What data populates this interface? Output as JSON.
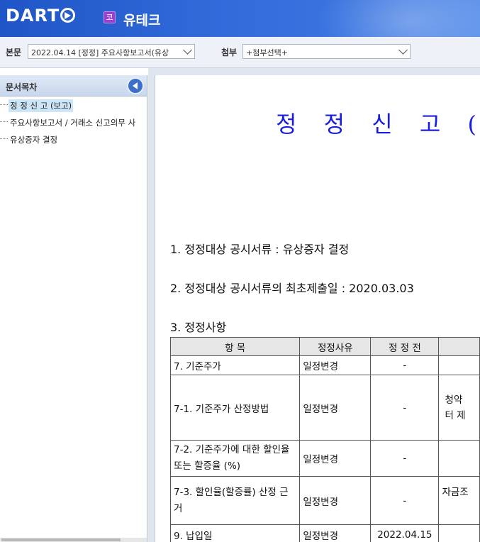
{
  "header": {
    "logo": "DART",
    "corp_badge": "코",
    "corp_name": "유테크"
  },
  "toolbar": {
    "body_label": "본문",
    "body_select": "2022.04.14 [정정] 주요사항보고서(유상",
    "attach_label": "첨부",
    "attach_select": "+첨부선택+"
  },
  "toc": {
    "title": "문서목차",
    "items": [
      {
        "label": "정 정 신 고 (보고)",
        "active": true
      },
      {
        "label": "주요사항보고서 / 거래소 신고의무 사",
        "active": false
      },
      {
        "label": "유상증자 결정",
        "active": false
      }
    ]
  },
  "document": {
    "title": "정 정 신 고 (보고)",
    "line1": "1. 정정대상 공시서류 : 유상증자 결정",
    "line2": "2. 정정대상 공시서류의 최초제출일 : 2020.03.03",
    "line3": "3. 정정사항",
    "table": {
      "headers": [
        "항  목",
        "정정사유",
        "정 정 전",
        ""
      ],
      "rows": [
        {
          "item": "7. 기준주가",
          "reason": "일정변경",
          "before": "-",
          "after": ""
        },
        {
          "item": "7-1. 기준주가 산정방법",
          "reason": "일정변경",
          "before": "-",
          "after": "청약\n터 제"
        },
        {
          "item": "7-2. 기준주가에 대한 할인율 또는 할증율 (%)",
          "reason": "일정변경",
          "before": "-",
          "after": ""
        },
        {
          "item": "7-3. 할인율(할증률) 산정 근거",
          "reason": "일정변경",
          "before": "-",
          "after": "자금조"
        },
        {
          "item": "9. 납입일",
          "reason": "일정변경",
          "before": "2022.04.15",
          "after": ""
        }
      ]
    }
  }
}
